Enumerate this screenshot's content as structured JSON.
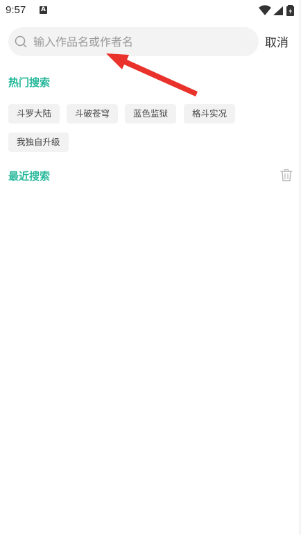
{
  "status_bar": {
    "time": "9:57",
    "app_icon": "A",
    "icons": [
      "wifi-icon",
      "cellular-signal-icon",
      "battery-icon"
    ]
  },
  "search": {
    "placeholder": "输入作品名或作者名",
    "value": "",
    "cancel_label": "取消"
  },
  "hot_search": {
    "title": "热门搜索",
    "tags": [
      "斗罗大陆",
      "斗破苍穹",
      "蓝色监狱",
      "格斗实况",
      "我独自升级"
    ]
  },
  "recent_search": {
    "title": "最近搜索",
    "items": []
  },
  "colors": {
    "accent": "#26b89a",
    "tag_background": "#f2f2f2",
    "search_background": "#f3f3f3",
    "annotation_arrow": "#e8322b"
  }
}
